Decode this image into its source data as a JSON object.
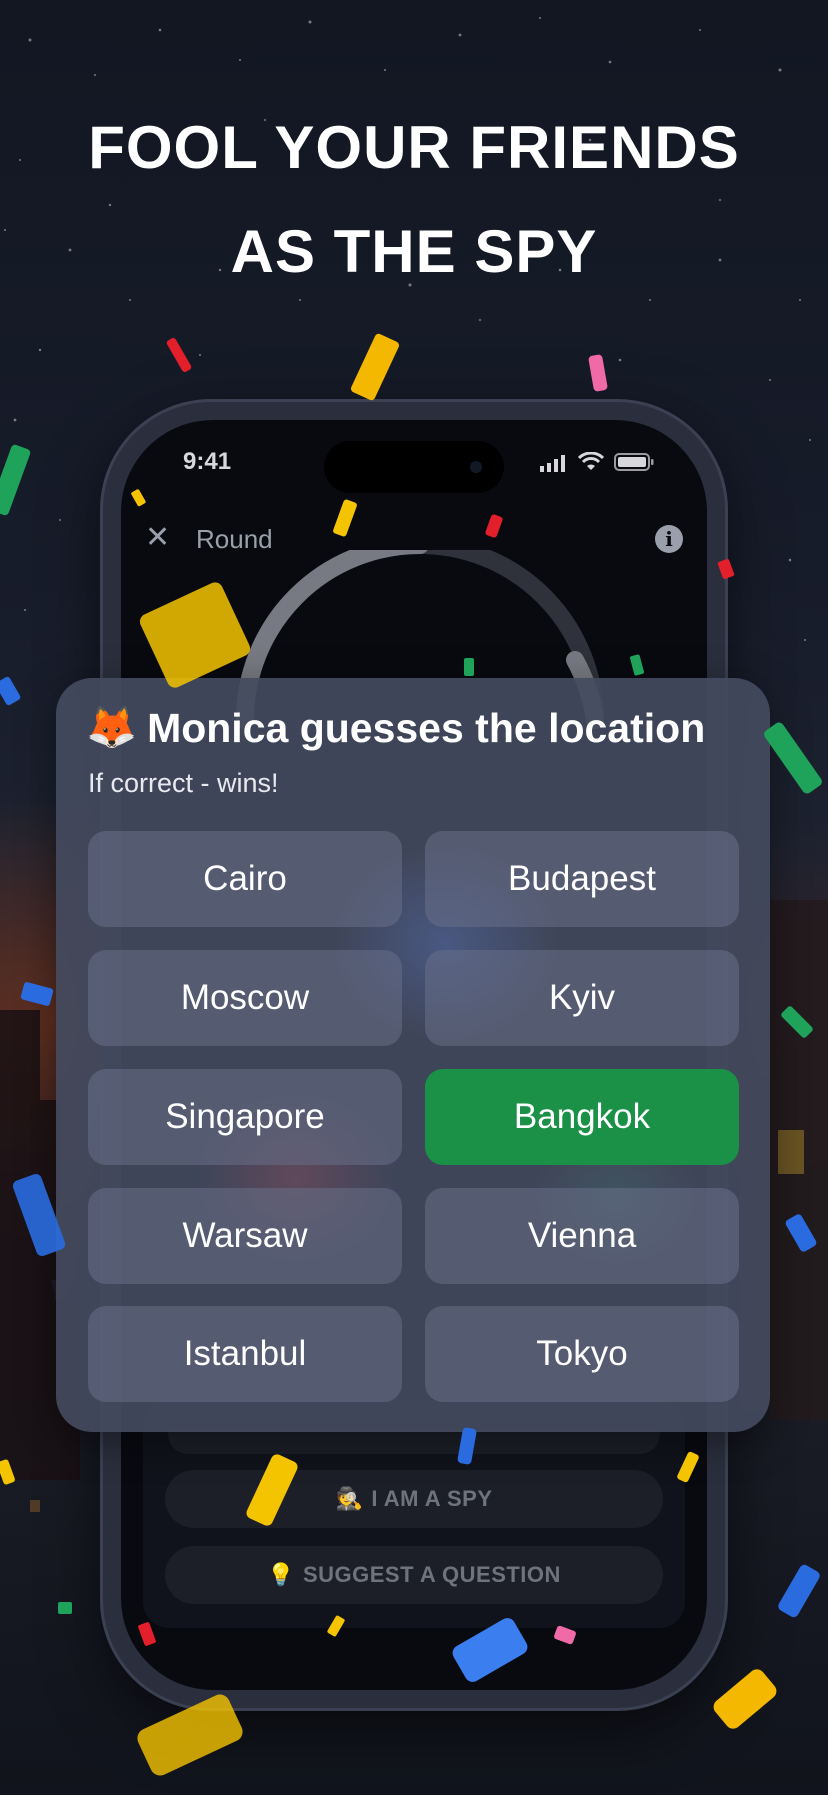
{
  "headline": {
    "line1": "FOOL YOUR FRIENDS",
    "line2": "AS THE SPY"
  },
  "status": {
    "time": "9:41"
  },
  "nav": {
    "close_glyph": "✕",
    "title": "Round",
    "info_glyph": "i"
  },
  "card": {
    "avatar_emoji": "🦊",
    "title": "Monica guesses the location",
    "subtitle": "If correct - wins!",
    "options": [
      {
        "label": "Cairo",
        "selected": false
      },
      {
        "label": "Budapest",
        "selected": false
      },
      {
        "label": "Moscow",
        "selected": false
      },
      {
        "label": "Kyiv",
        "selected": false
      },
      {
        "label": "Singapore",
        "selected": false
      },
      {
        "label": "Bangkok",
        "selected": true
      },
      {
        "label": "Warsaw",
        "selected": false
      },
      {
        "label": "Vienna",
        "selected": false
      },
      {
        "label": "Istanbul",
        "selected": false
      },
      {
        "label": "Tokyo",
        "selected": false
      }
    ],
    "selected_color": "#1b9148"
  },
  "actions": {
    "spy_emoji": "🕵",
    "spy_label": "I AM A SPY",
    "suggest_emoji": "💡",
    "suggest_label": "SUGGEST A QUESTION"
  },
  "icons": {
    "close": "close-icon",
    "info": "info-icon",
    "signal": "cellular-signal-icon",
    "wifi": "wifi-icon",
    "battery": "battery-icon"
  }
}
